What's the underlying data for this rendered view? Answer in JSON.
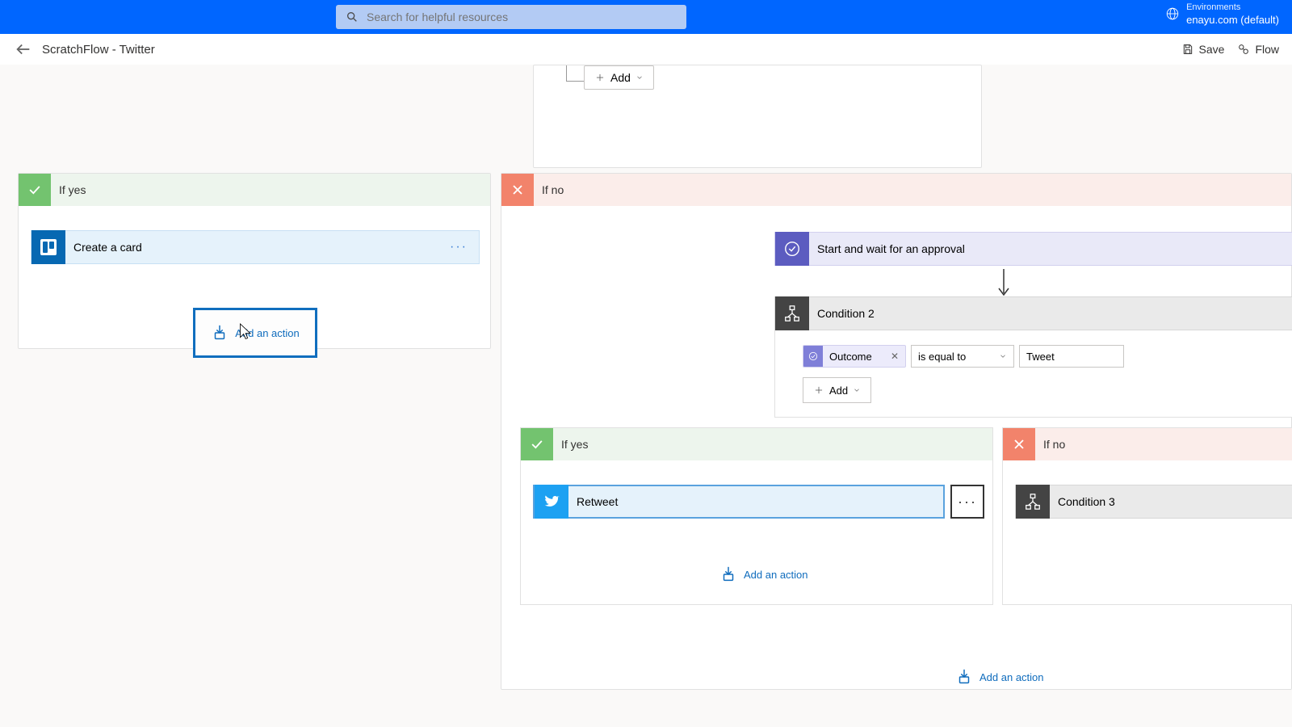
{
  "topbar": {
    "search_placeholder": "Search for helpful resources",
    "env_label": "Environments",
    "env_name": "enayu.com (default)"
  },
  "subbar": {
    "flow_title": "ScratchFlow - Twitter",
    "save": "Save",
    "flowcheck": "Flow"
  },
  "top_add": {
    "add": "Add"
  },
  "branch_left": {
    "title": "If yes",
    "trello_label": "Create a card",
    "add_action": "Add an action"
  },
  "branch_right": {
    "title": "If no",
    "approval_label": "Start and wait for an approval",
    "cond2_label": "Condition 2",
    "cond2_chip": "Outcome",
    "cond2_op": "is equal to",
    "cond2_val": "Tweet",
    "cond2_add": "Add",
    "nested_yes": {
      "title": "If yes",
      "retweet_label": "Retweet",
      "add_action": "Add an action"
    },
    "nested_no": {
      "title": "If no",
      "cond3_label": "Condition 3"
    },
    "outer_add": "Add an action"
  }
}
